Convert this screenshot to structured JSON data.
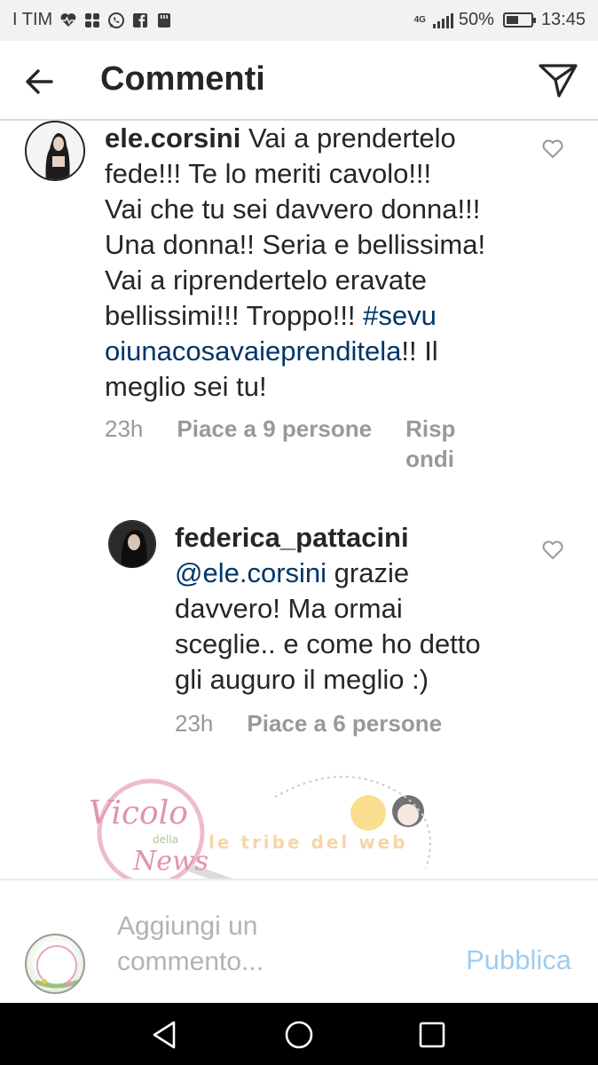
{
  "status_bar": {
    "carrier": "I TIM",
    "network": "4G",
    "battery": "50%",
    "battery_level": 0.5,
    "time": "13:45",
    "icons": [
      "heart-monitor-icon",
      "apps-icon",
      "whatsapp-icon",
      "facebook-icon",
      "sd-card-icon"
    ]
  },
  "header": {
    "title": "Commenti",
    "back_icon": "arrow-left-icon",
    "send_icon": "send-icon"
  },
  "comments": [
    {
      "username": "ele.corsini",
      "text_lines": [
        " Vai a prendertelo",
        "fede!!! Te lo meriti cavolo!!!",
        "Vai che tu sei davvero donna!!!",
        "Una donna!! Seria e bellissima!",
        "Vai a riprendertelo eravate",
        "bellissimi!!! Troppo!!! "
      ],
      "hashtag_part1": "#sevu",
      "hashtag_part2": "oiunacosavaieprenditela",
      "after_hashtag": "!! Il",
      "last_line": "meglio sei tu!",
      "time": "23h",
      "likes": "Piace a 9 persone",
      "reply_part1": "Risp",
      "reply_part2": "ondi"
    },
    {
      "username": "federica_pattacini",
      "mention": "@ele.corsini",
      "text_after_mention": " grazie",
      "text_lines": [
        "davvero! Ma ormai",
        "sceglie.. e come ho detto",
        "gli auguro il meglio :)"
      ],
      "time": "23h",
      "likes": "Piace a 6 persone"
    }
  ],
  "add_comment": {
    "placeholder_line1": "Aggiungi un",
    "placeholder_line2": "commento...",
    "publish": "Pubblica"
  },
  "watermark": {
    "line1": "Vicolo",
    "line2": "della",
    "line3": "News",
    "subtitle": "le tribe del web"
  },
  "colors": {
    "hashtag": "#003569",
    "meta": "#999999",
    "publish": "#9fcdf0",
    "text": "#262626"
  }
}
